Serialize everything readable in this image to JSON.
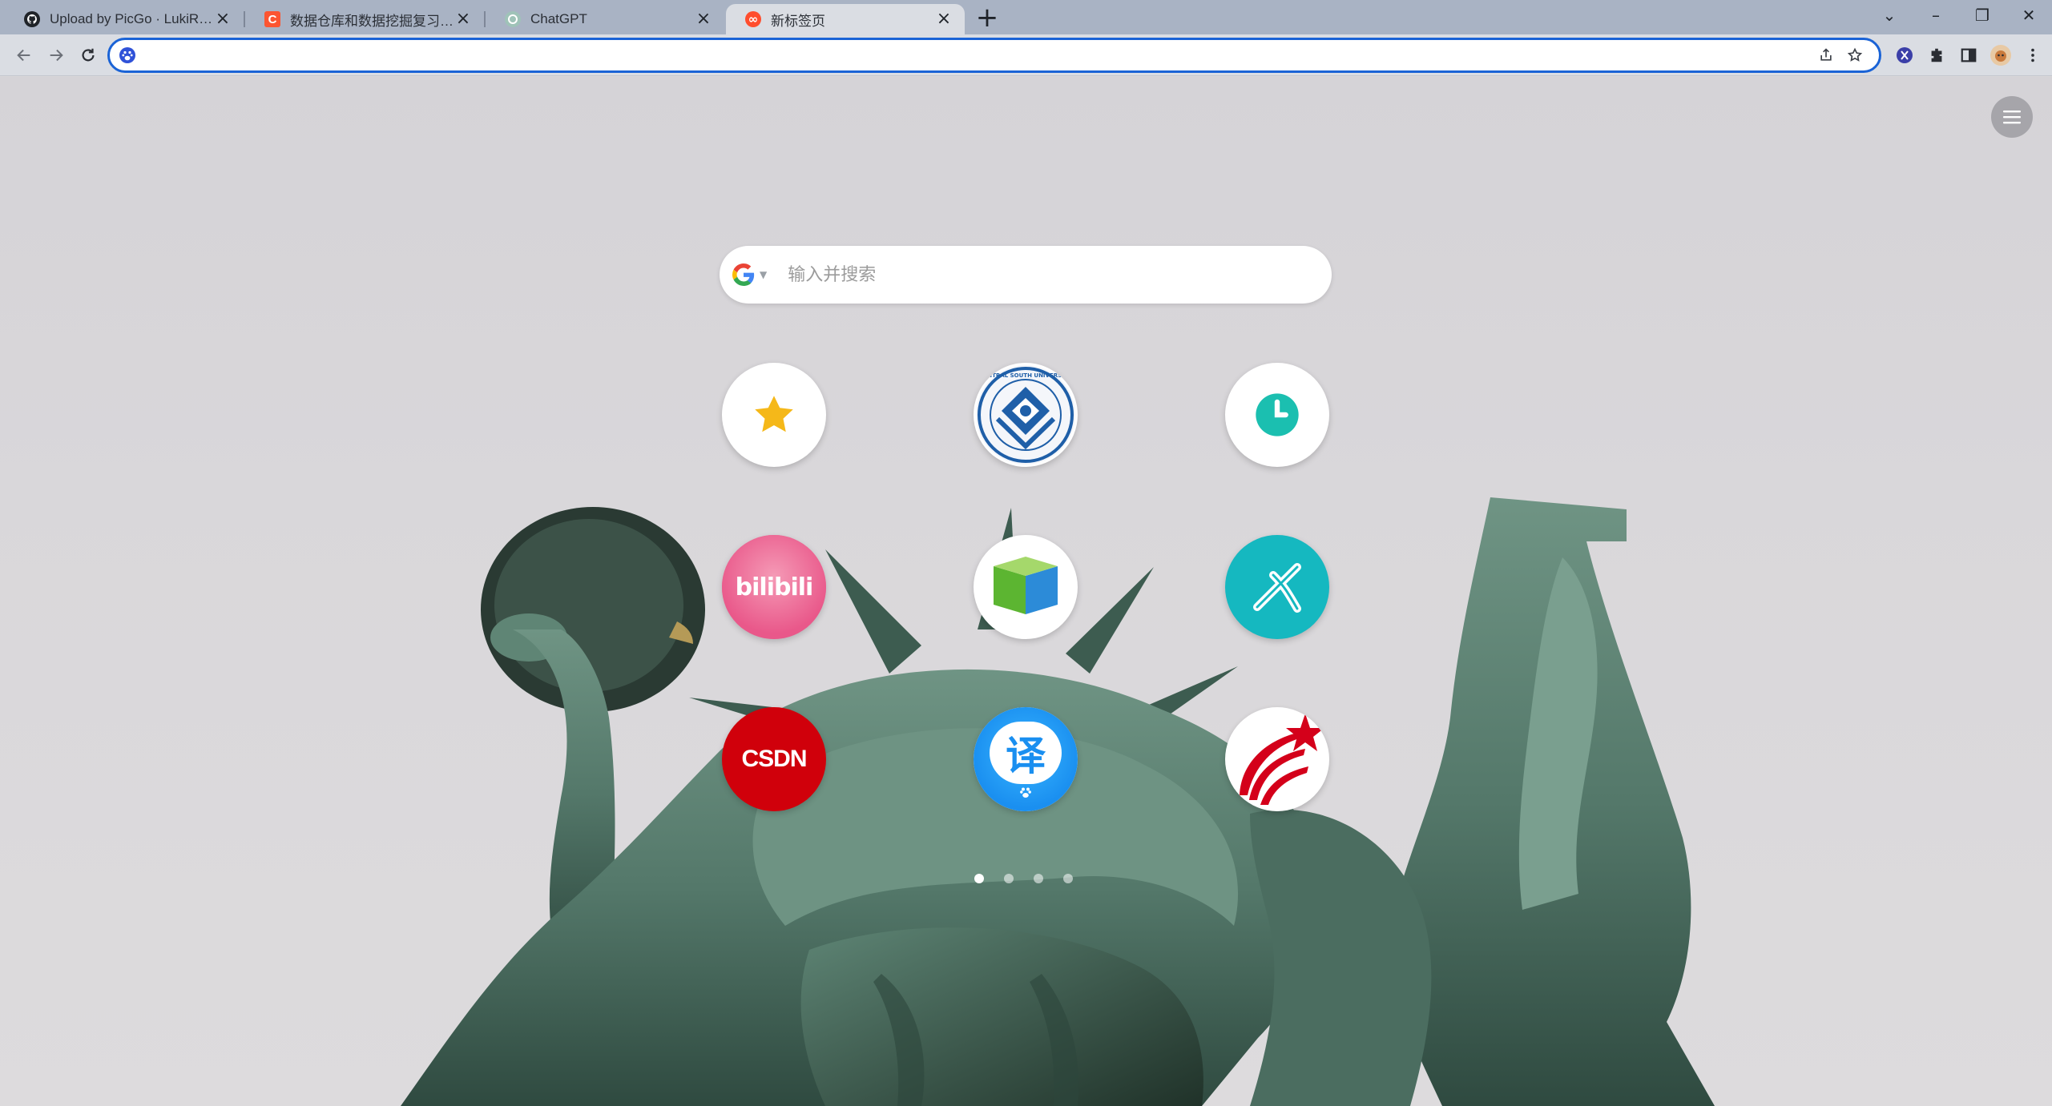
{
  "browser": {
    "tabs": [
      {
        "title": "Upload by PicGo · LukiRyan/T",
        "favicon": "github-icon",
        "active": false
      },
      {
        "title": "数据仓库和数据挖掘复习_名词解",
        "favicon": "csdn-c-icon",
        "active": false
      },
      {
        "title": "ChatGPT",
        "favicon": "chatgpt-icon",
        "active": false
      },
      {
        "title": "新标签页",
        "favicon": "infinity-icon",
        "active": true
      }
    ],
    "new_tab_label": "+",
    "window_controls": {
      "tabsearch": "⌄",
      "minimize": "–",
      "restore": "❐",
      "close": "✕"
    },
    "address_bar": {
      "value": "",
      "engine_icon": "baidu-paw-icon"
    }
  },
  "newtab": {
    "search": {
      "placeholder": "输入并搜索",
      "engine": "google-icon"
    },
    "shortcuts": [
      {
        "name": "bookmarks",
        "icon": "star-icon"
      },
      {
        "name": "central-south-university",
        "icon": "csu-logo-icon",
        "logo_text": "CENTRAL SOUTH UNIVERSITY"
      },
      {
        "name": "history",
        "icon": "clock-icon"
      },
      {
        "name": "bilibili",
        "icon": "bilibili-icon",
        "text": "bilibili"
      },
      {
        "name": "tencent-docs",
        "icon": "book-icon"
      },
      {
        "name": "app-x",
        "icon": "teal-x-icon"
      },
      {
        "name": "csdn",
        "icon": "csdn-icon",
        "text": "CSDN"
      },
      {
        "name": "baidu-translate",
        "icon": "translate-icon",
        "text": "译"
      },
      {
        "name": "xuexi",
        "icon": "xuexi-icon"
      }
    ],
    "pagination": {
      "pages": 4,
      "current": 1
    }
  },
  "colors": {
    "accent": "#1a63d6",
    "tab_strip": "#a9b3c4",
    "toolbar": "#dadde3"
  }
}
